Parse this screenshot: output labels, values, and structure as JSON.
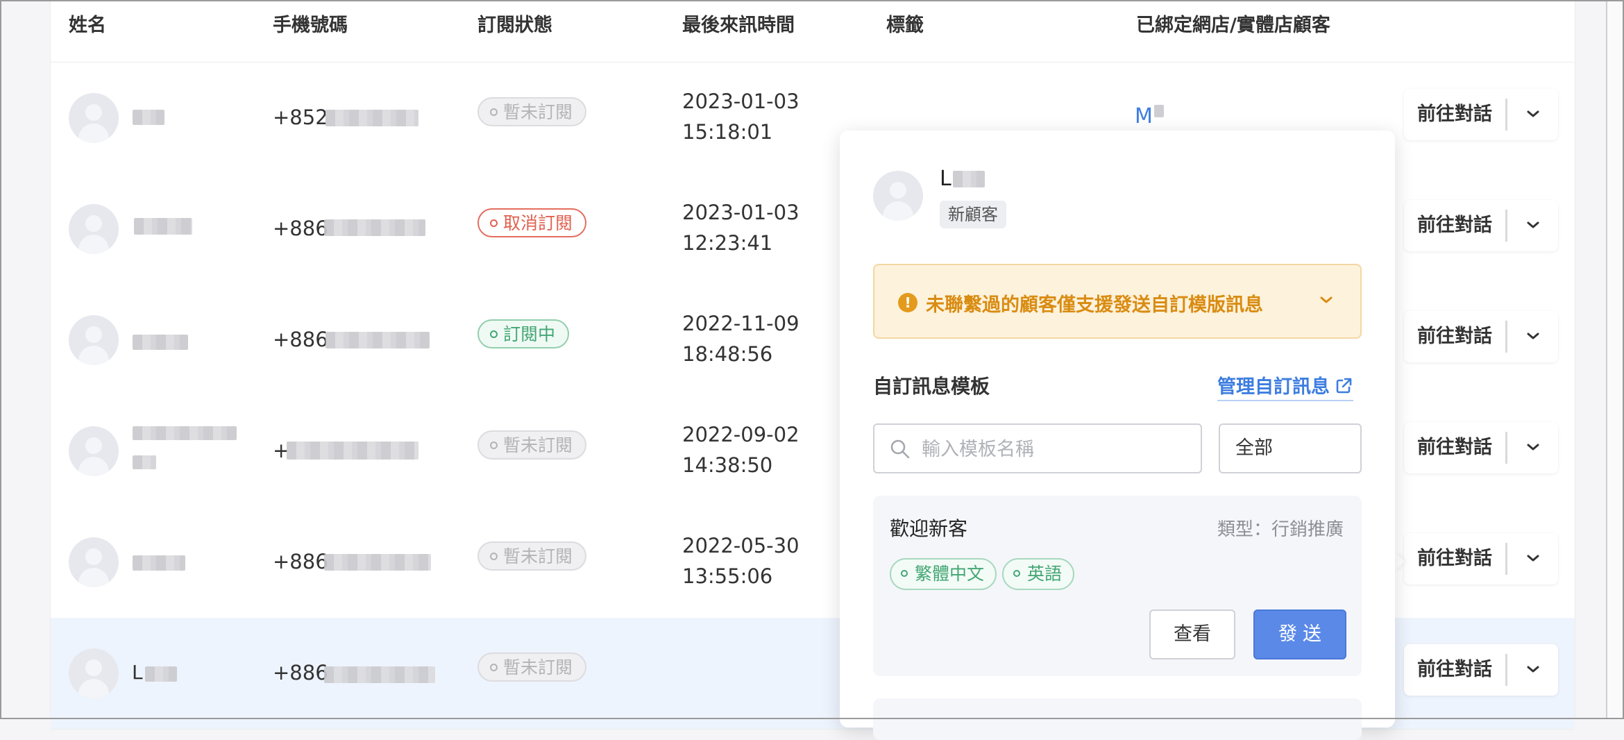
{
  "table": {
    "headers": [
      "姓名",
      "手機號碼",
      "訂閱狀態",
      "最後來訊時間",
      "標籤",
      "已綁定網店/實體店顧客"
    ],
    "rows": [
      {
        "name": "",
        "phone": "+852",
        "status": "暫未訂閱",
        "status_kind": "none",
        "date": "2023-01-03",
        "time": "15:18:01",
        "linked": "M",
        "action": "前往對話"
      },
      {
        "name": "",
        "phone": "+886",
        "status": "取消訂閱",
        "status_kind": "cancel",
        "date": "2023-01-03",
        "time": "12:23:41",
        "linked": "",
        "action": "前往對話"
      },
      {
        "name": "",
        "phone": "+886",
        "status": "訂閱中",
        "status_kind": "active",
        "date": "2022-11-09",
        "time": "18:48:56",
        "linked": "",
        "action": "前往對話"
      },
      {
        "name": "",
        "phone": "+",
        "status": "暫未訂閱",
        "status_kind": "none",
        "date": "2022-09-02",
        "time": "14:38:50",
        "linked": "",
        "action": "前往對話"
      },
      {
        "name": "",
        "phone": "+886",
        "status": "暫未訂閱",
        "status_kind": "none",
        "date": "2022-05-30",
        "time": "13:55:06",
        "linked": "",
        "action": "前往對話"
      },
      {
        "name": "L",
        "phone": "+886",
        "status": "暫未訂閱",
        "status_kind": "none",
        "date": "",
        "time": "",
        "linked": "",
        "action": "前往對話"
      }
    ]
  },
  "popover": {
    "customer_name": "L",
    "customer_badge": "新顧客",
    "warning": "未聯繫過的顧客僅支援發送自訂模版訊息",
    "section_title": "自訂訊息模板",
    "manage_link": "管理自訂訊息",
    "search": {
      "placeholder": "輸入模板名稱",
      "value": ""
    },
    "filter": {
      "selected": "全部"
    },
    "template": {
      "title": "歡迎新客",
      "type": "類型：行銷推廣",
      "tags": [
        "繁體中文",
        "英語"
      ],
      "view_label": "查看",
      "send_label": "發送"
    }
  },
  "colors": {
    "accent": "#3d7de0",
    "send_button": "#5b89e8",
    "warning_text": "#d98c12",
    "warning_bg": "#fdf2dc",
    "status_cancel": "#e0614f",
    "status_active": "#43a673",
    "status_none": "#b3b3b8"
  },
  "icons": {
    "avatar": "person-silhouette-icon",
    "dropdown": "chevron-down-icon",
    "warning": "exclamation-circle-icon",
    "external": "external-link-icon",
    "search": "search-icon"
  }
}
